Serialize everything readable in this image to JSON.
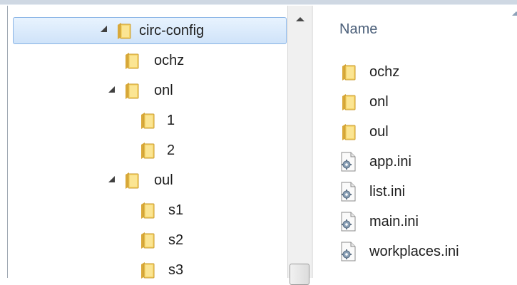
{
  "tree": {
    "items": [
      {
        "label": "circ-config",
        "expander": "expanded",
        "selected": true
      },
      {
        "label": "ochz",
        "expander": "none"
      },
      {
        "label": "onl",
        "expander": "expanded"
      },
      {
        "label": "1",
        "expander": "none"
      },
      {
        "label": "2",
        "expander": "none"
      },
      {
        "label": "oul",
        "expander": "expanded"
      },
      {
        "label": "s1",
        "expander": "collapsed"
      },
      {
        "label": "s2",
        "expander": "collapsed"
      },
      {
        "label": "s3",
        "expander": "collapsed"
      }
    ]
  },
  "list": {
    "column_name": "Name",
    "items": [
      {
        "label": "ochz",
        "icon": "folder-icon"
      },
      {
        "label": "onl",
        "icon": "folder-icon"
      },
      {
        "label": "oul",
        "icon": "folder-icon"
      },
      {
        "label": "app.ini",
        "icon": "config-file-icon"
      },
      {
        "label": "list.ini",
        "icon": "config-file-icon"
      },
      {
        "label": "main.ini",
        "icon": "config-file-icon"
      },
      {
        "label": "workplaces.ini",
        "icon": "config-file-icon"
      }
    ]
  },
  "colors": {
    "selection_fill": "#cfe3f9",
    "selection_border": "#89b4e6",
    "folder": "#f2c94c",
    "header_text": "#4c607a"
  }
}
